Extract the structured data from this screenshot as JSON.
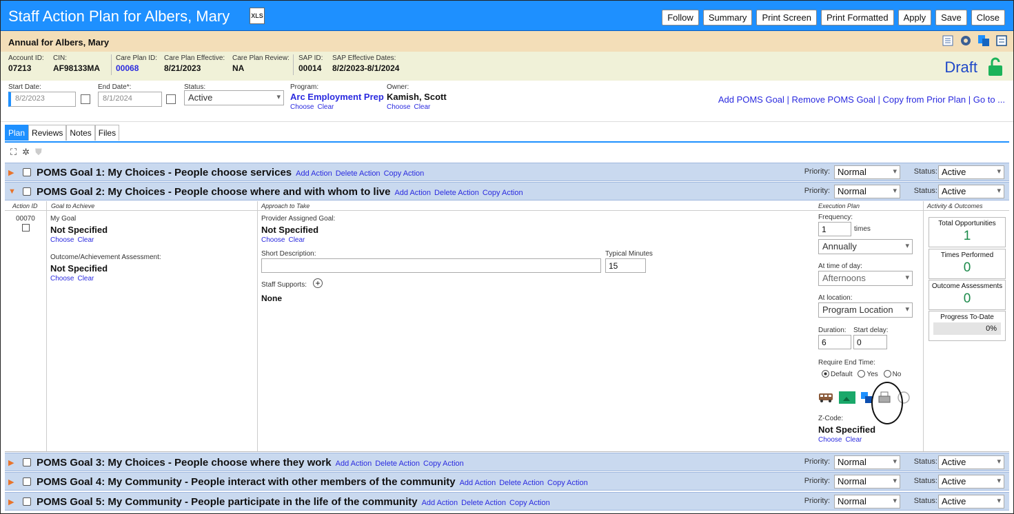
{
  "header": {
    "title": "Staff Action Plan for Albers, Mary",
    "xls_label": "XLS",
    "buttons": [
      "Follow",
      "Summary",
      "Print Screen",
      "Print Formatted",
      "Apply",
      "Save",
      "Close"
    ]
  },
  "subheader": {
    "title": "Annual for Albers, Mary"
  },
  "info": {
    "account_id_label": "Account ID:",
    "account_id": "07213",
    "cin_label": "CIN:",
    "cin": "AF98133MA",
    "care_plan_id_label": "Care Plan ID:",
    "care_plan_id": "00068",
    "care_plan_effective_label": "Care Plan Effective:",
    "care_plan_effective": "8/21/2023",
    "care_plan_review_label": "Care Plan Review:",
    "care_plan_review": "NA",
    "sap_id_label": "SAP ID:",
    "sap_id": "00014",
    "sap_dates_label": "SAP Effective Dates:",
    "sap_dates": "8/2/2023-8/1/2024",
    "status": "Draft"
  },
  "filters": {
    "start_label": "Start Date:",
    "start_value": "8/2/2023",
    "end_label": "End Date*:",
    "end_value": "8/1/2024",
    "status_label": "Status:",
    "status_value": "Active",
    "program_label": "Program:",
    "program_value": "Arc Employment Prep",
    "owner_label": "Owner:",
    "owner_value": "Kamish, Scott",
    "choose": "Choose",
    "clear": "Clear",
    "links": "Add POMS Goal | Remove POMS Goal | Copy from Prior Plan | Go to ..."
  },
  "tabs": [
    "Plan",
    "Reviews",
    "Notes",
    "Files"
  ],
  "goal_actions": {
    "add": "Add Action",
    "delete": "Delete Action",
    "copy": "Copy Action"
  },
  "priority_label": "Priority:",
  "status_label": "Status:",
  "goals": [
    {
      "title": "POMS Goal 1: My Choices - People choose services",
      "priority": "Normal",
      "status": "Active"
    },
    {
      "title": "POMS Goal 2: My Choices - People choose where and with whom to live",
      "priority": "Normal",
      "status": "Active"
    },
    {
      "title": "POMS Goal 3: My Choices - People choose where they work",
      "priority": "Normal",
      "status": "Active"
    },
    {
      "title": "POMS Goal 4: My Community - People interact with other members of the community",
      "priority": "Normal",
      "status": "Active"
    },
    {
      "title": "POMS Goal 5: My Community - People participate in the life of the community",
      "priority": "Normal",
      "status": "Active"
    }
  ],
  "detail": {
    "col_action_id": "Action ID",
    "col_goal": "Goal to Achieve",
    "col_approach": "Approach to Take",
    "col_execution": "Execution Plan",
    "col_activity": "Activity & Outcomes",
    "action_id": "00070",
    "my_goal_label": "My Goal",
    "my_goal_value": "Not Specified",
    "outcome_label": "Outcome/Achievement Assessment:",
    "outcome_value": "Not Specified",
    "provider_goal_label": "Provider Assigned Goal:",
    "provider_goal_value": "Not Specified",
    "short_desc_label": "Short Description:",
    "short_desc_value": "",
    "typical_minutes_label": "Typical Minutes",
    "typical_minutes": "15",
    "staff_supports_label": "Staff Supports:",
    "staff_supports_value": "None",
    "frequency_label": "Frequency:",
    "frequency": "1",
    "times": "times",
    "period": "Annually",
    "time_of_day_label": "At time of day:",
    "time_of_day": "Afternoons",
    "location_label": "At location:",
    "location": "Program Location",
    "duration_label": "Duration:",
    "duration": "6",
    "start_delay_label": "Start delay:",
    "start_delay": "0",
    "require_end_label": "Require End Time:",
    "radio_default": "Default",
    "radio_yes": "Yes",
    "radio_no": "No",
    "zcode_label": "Z-Code:",
    "zcode_value": "Not Specified",
    "total_opp_label": "Total Opportunities",
    "total_opp": "1",
    "times_performed_label": "Times Performed",
    "times_performed": "0",
    "outcome_assess_label": "Outcome Assessments",
    "outcome_assess": "0",
    "progress_label": "Progress To-Date",
    "progress": "0%"
  },
  "colors": {
    "accent": "#1e90ff",
    "goal_row": "#c9d9ef",
    "subheader": "#f3deb8",
    "info": "#f0f1d8"
  }
}
